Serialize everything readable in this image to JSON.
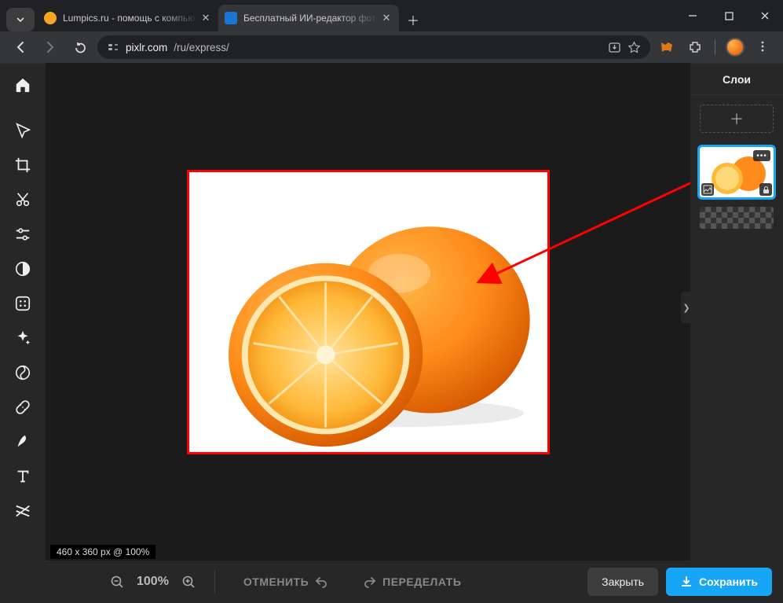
{
  "window": {
    "tabs": [
      {
        "title": "Lumpics.ru - помощь с компью",
        "favColor": "#f6a623"
      },
      {
        "title": "Бесплатный ИИ-редактор фот",
        "favColor": "#1976d2"
      }
    ],
    "url_host": "pixlr.com",
    "url_path": "/ru/express/"
  },
  "layers": {
    "title": "Слои"
  },
  "canvas": {
    "status": "460 x 360 px @ 100%"
  },
  "bottom": {
    "zoom": "100%",
    "undo": "ОТМЕНИТЬ",
    "redo": "ПЕРЕДЕЛАТЬ",
    "close": "Закрыть",
    "save": "Сохранить"
  }
}
